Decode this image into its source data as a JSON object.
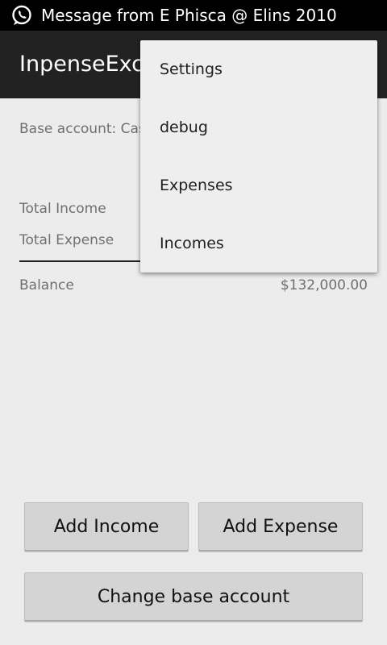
{
  "status_bar": {
    "notification_icon": "whatsapp-icon",
    "message": "Message from E Phisca @ Elins 2010"
  },
  "action_bar": {
    "title": "InpenseExc"
  },
  "summary": {
    "base_account_label": "Base account: Cash",
    "total_income_label": "Total Income",
    "total_expense_label": "Total Expense",
    "balance_label": "Balance",
    "balance_value": "$132,000.00"
  },
  "buttons": {
    "add_income": "Add Income",
    "add_expense": "Add Expense",
    "change_base_account": "Change base account"
  },
  "overflow_menu": {
    "items": [
      {
        "label": "Settings"
      },
      {
        "label": "debug"
      },
      {
        "label": "Expenses"
      },
      {
        "label": "Incomes"
      }
    ]
  }
}
